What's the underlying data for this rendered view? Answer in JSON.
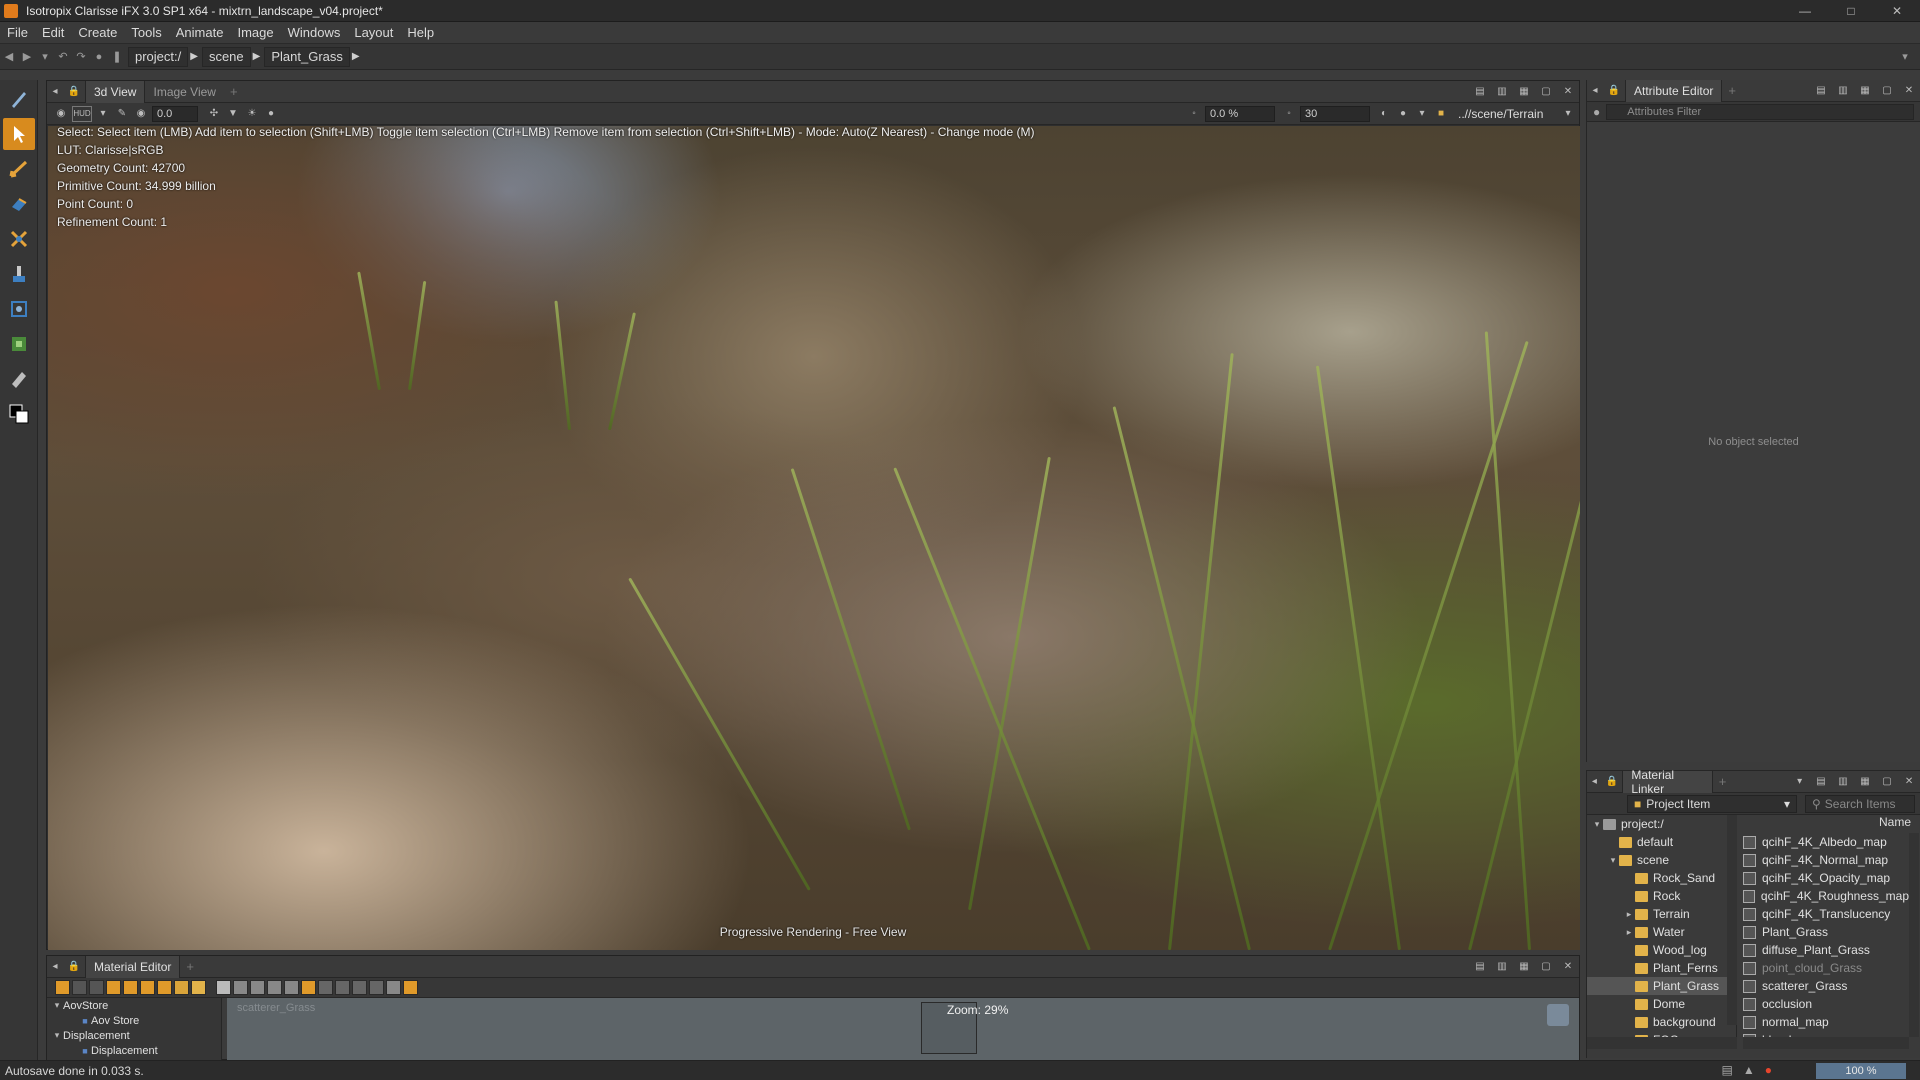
{
  "window": {
    "title": "Isotropix Clarisse iFX 3.0 SP1 x64  - mixtrn_landscape_v04.project*"
  },
  "menu": [
    "File",
    "Edit",
    "Create",
    "Tools",
    "Animate",
    "Image",
    "Windows",
    "Layout",
    "Help"
  ],
  "path": {
    "crumbs": [
      "project:/",
      "scene",
      "Plant_Grass"
    ]
  },
  "view3d": {
    "tabs": [
      "3d View",
      "Image View"
    ],
    "toolbar": {
      "value1": "0.0",
      "percent": "0.0 %",
      "samples": "30",
      "camera": "..//scene/Terrain"
    },
    "hint": "Select: Select item (LMB)  Add item to selection (Shift+LMB)  Toggle item selection (Ctrl+LMB)  Remove item from selection (Ctrl+Shift+LMB)  - Mode: Auto(Z Nearest) - Change mode (M)",
    "info": [
      "LUT: Clarisse|sRGB",
      "Geometry Count: 42700",
      "Primitive Count: 34.999 billion",
      "Point Count: 0",
      "Refinement Count: 1"
    ],
    "status": "Progressive Rendering - Free View"
  },
  "attribute_editor": {
    "tab": "Attribute Editor",
    "filter_placeholder": "Attributes Filter",
    "empty": "No object selected"
  },
  "material_linker": {
    "tab": "Material Linker",
    "project_item": "Project Item",
    "search_placeholder": "Search Items",
    "name_header": "Name",
    "tree": [
      {
        "label": "project:/",
        "depth": 0,
        "twisty": "▾"
      },
      {
        "label": "default",
        "depth": 1,
        "twisty": ""
      },
      {
        "label": "scene",
        "depth": 1,
        "twisty": "▾"
      },
      {
        "label": "Rock_Sand",
        "depth": 2,
        "twisty": ""
      },
      {
        "label": "Rock",
        "depth": 2,
        "twisty": ""
      },
      {
        "label": "Terrain",
        "depth": 2,
        "twisty": "▸"
      },
      {
        "label": "Water",
        "depth": 2,
        "twisty": "▸"
      },
      {
        "label": "Wood_log",
        "depth": 2,
        "twisty": ""
      },
      {
        "label": "Plant_Ferns",
        "depth": 2,
        "twisty": ""
      },
      {
        "label": "Plant_Grass",
        "depth": 2,
        "twisty": "",
        "selected": true
      },
      {
        "label": "Dome",
        "depth": 2,
        "twisty": ""
      },
      {
        "label": "background",
        "depth": 2,
        "twisty": ""
      },
      {
        "label": "FOG",
        "depth": 2,
        "twisty": ""
      }
    ],
    "items": [
      "qcihF_4K_Albedo_map",
      "qcihF_4K_Normal_map",
      "qcihF_4K_Opacity_map",
      "qcihF_4K_Roughness_map",
      "qcihF_4K_Translucency",
      "Plant_Grass",
      "diffuse_Plant_Grass",
      "point_cloud_Grass",
      "scatterer_Grass",
      "occlusion",
      "normal_map",
      "blend"
    ]
  },
  "material_editor": {
    "tab": "Material Editor",
    "tree": [
      {
        "label": "AovStore",
        "depth": 0
      },
      {
        "label": "Aov Store",
        "depth": 1
      },
      {
        "label": "Displacement",
        "depth": 0
      },
      {
        "label": "Displacement",
        "depth": 1
      }
    ],
    "graph_label": "scatterer_Grass",
    "zoom": "Zoom: 29%"
  },
  "statusbar": {
    "message": "Autosave done in 0.033 s.",
    "zoom": "100 %"
  }
}
